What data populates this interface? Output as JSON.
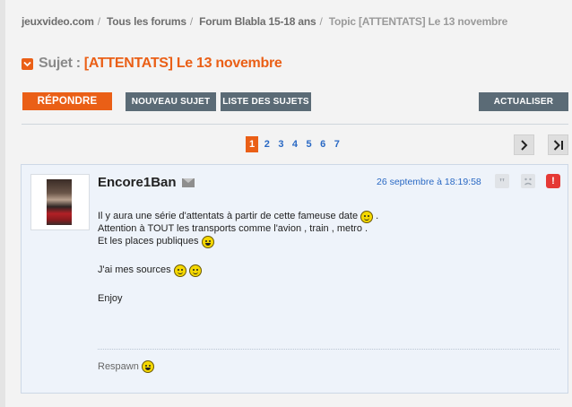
{
  "breadcrumb": {
    "site": "jeuxvideo.com",
    "forums": "Tous les forums",
    "forum": "Forum Blabla 15-18 ans",
    "topic": "Topic [ATTENTATS] Le 13 novembre"
  },
  "topic": {
    "label": "Sujet :",
    "title": "[ATTENTATS] Le 13 novembre"
  },
  "toolbar": {
    "reply": "RÉPONDRE",
    "new_topic": "NOUVEAU SUJET",
    "topic_list": "LISTE DES SUJETS",
    "refresh": "ACTUALISER"
  },
  "pagination": {
    "pages": [
      "1",
      "2",
      "3",
      "4",
      "5",
      "6",
      "7"
    ],
    "current": "1"
  },
  "post": {
    "author": "Encore1Ban",
    "date": "26 septembre à 18:19:58",
    "lines": [
      "Il y aura une série d'attentats à partir de cette fameuse date",
      "Attention à TOUT les transports comme l'avion , train , metro .",
      "Et les places publiques",
      "J'ai mes sources",
      "Enjoy"
    ],
    "signature": "Respawn"
  },
  "colors": {
    "accent": "#ea5f16",
    "button_dark": "#5b6b76",
    "link": "#2a69c4",
    "post_bg": "#eef3fa"
  }
}
